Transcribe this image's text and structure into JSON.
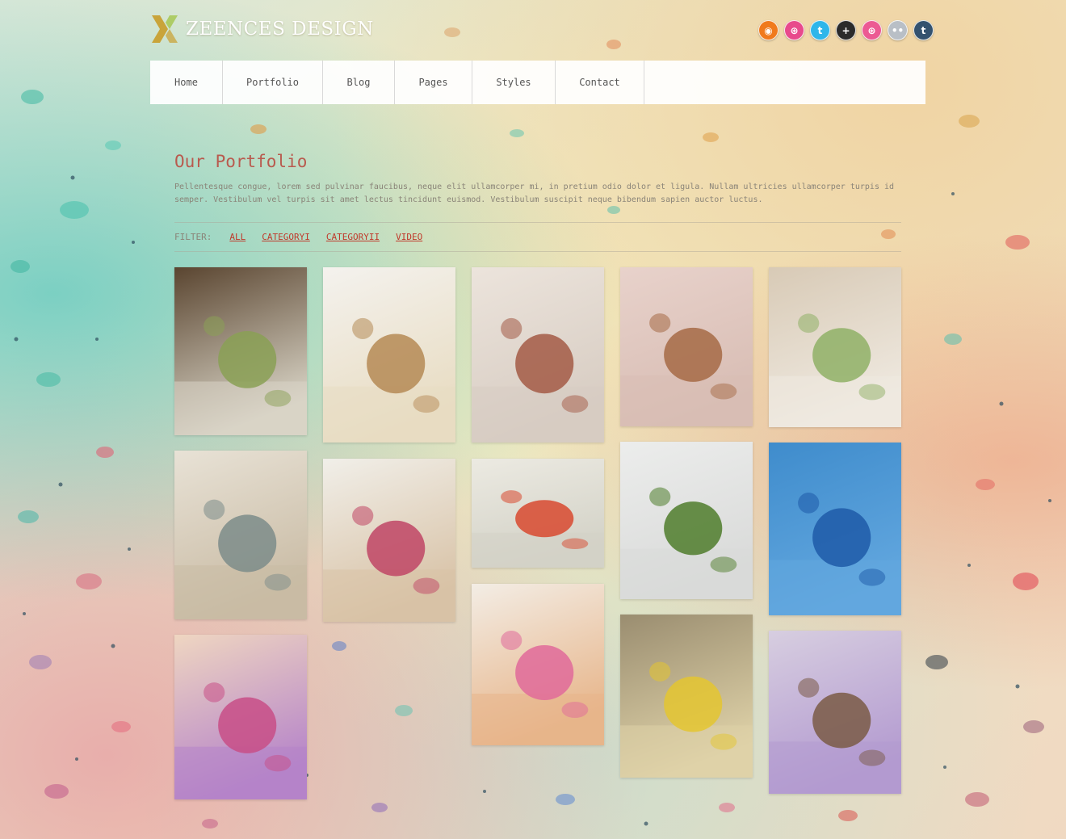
{
  "header": {
    "logo_text": "ZEENCES DESIGN",
    "social_icons": [
      {
        "name": "rss-icon",
        "color": "#f07a1d",
        "glyph": "◉"
      },
      {
        "name": "dribbble-icon",
        "color": "#e84a8c",
        "glyph": "⊛"
      },
      {
        "name": "twitter-icon",
        "color": "#2eb6ea",
        "glyph": "t"
      },
      {
        "name": "plus-icon",
        "color": "#2b2b2b",
        "glyph": "+"
      },
      {
        "name": "dribbble-alt-icon",
        "color": "#ec5a93",
        "glyph": "⊛"
      },
      {
        "name": "flickr-icon",
        "color": "#b9bfc6",
        "glyph": "••"
      },
      {
        "name": "tumblr-icon",
        "color": "#34526f",
        "glyph": "t"
      }
    ]
  },
  "nav": {
    "items": [
      "Home",
      "Portfolio",
      "Blog",
      "Pages",
      "Styles",
      "Contact"
    ]
  },
  "main": {
    "title": "Our Portfolio",
    "intro": "Pellentesque congue, lorem sed pulvinar faucibus, neque elit ullamcorper mi, in pretium odio dolor et ligula. Nullam ultricies ullamcorper turpis id semper. Vestibulum vel turpis sit amet lectus tincidunt euismod. Vestibulum suscipit neque bibendum sapien auctor luctus.",
    "filter": {
      "label": "FILTER:",
      "options": [
        "ALL",
        "CATEGORYI",
        "CATEGORYII",
        "VIDEO"
      ]
    }
  },
  "colors": {
    "accent": "#c0392b",
    "title": "#b95a4e",
    "body_text": "#8a8478",
    "logo_gold": "#c9a43a"
  },
  "portfolio": [
    {
      "name": "spa-towel-branch-image",
      "palette": [
        "#5a4530",
        "#d9d4c6",
        "#8aa055"
      ]
    },
    {
      "name": "comb-towel-flowers-image",
      "palette": [
        "#f4f2ee",
        "#e8dcc2",
        "#b58a55"
      ]
    },
    {
      "name": "kitchen-herbs-bottles-image",
      "palette": [
        "#ece4dc",
        "#d7ccc2",
        "#a35a45"
      ]
    },
    {
      "name": "corner-shelf-plant-image",
      "palette": [
        "#e8d2cb",
        "#d8bdb4",
        "#a66a45"
      ]
    },
    {
      "name": "sink-faucet-wheat-image",
      "palette": [
        "#d8cab6",
        "#efe9e0",
        "#8fb066"
      ]
    },
    {
      "name": "watering-can-wall-image",
      "palette": [
        "#e8e2d6",
        "#c9bba4",
        "#7c8c8a"
      ]
    },
    {
      "name": "bookshelf-desk-room-image",
      "palette": [
        "#f1efe9",
        "#d8c2a6",
        "#c04565"
      ]
    },
    {
      "name": "kitchen-vegetables-image",
      "palette": [
        "#eceae2",
        "#d3d2c7",
        "#d8492f"
      ]
    },
    {
      "name": "plant-black-chair-image",
      "palette": [
        "#ecedec",
        "#d9dad9",
        "#4f7d2b"
      ]
    },
    {
      "name": "blue-room-sofa-image",
      "palette": [
        "#3f8ccc",
        "#62a7df",
        "#1e5aa8"
      ]
    },
    {
      "name": "purple-sofa-room-image",
      "palette": [
        "#efd6c1",
        "#b583c9",
        "#c84e86"
      ]
    },
    {
      "name": "candles-pink-flowers-image",
      "palette": [
        "#f3ede5",
        "#e7b58a",
        "#e06a9a"
      ]
    },
    {
      "name": "yellow-flowers-jars-image",
      "palette": [
        "#9a8d70",
        "#dfd2a8",
        "#e4c530"
      ]
    },
    {
      "name": "purple-flowers-bottle-image",
      "palette": [
        "#d7cee0",
        "#b39ad0",
        "#7a5a45"
      ]
    }
  ]
}
